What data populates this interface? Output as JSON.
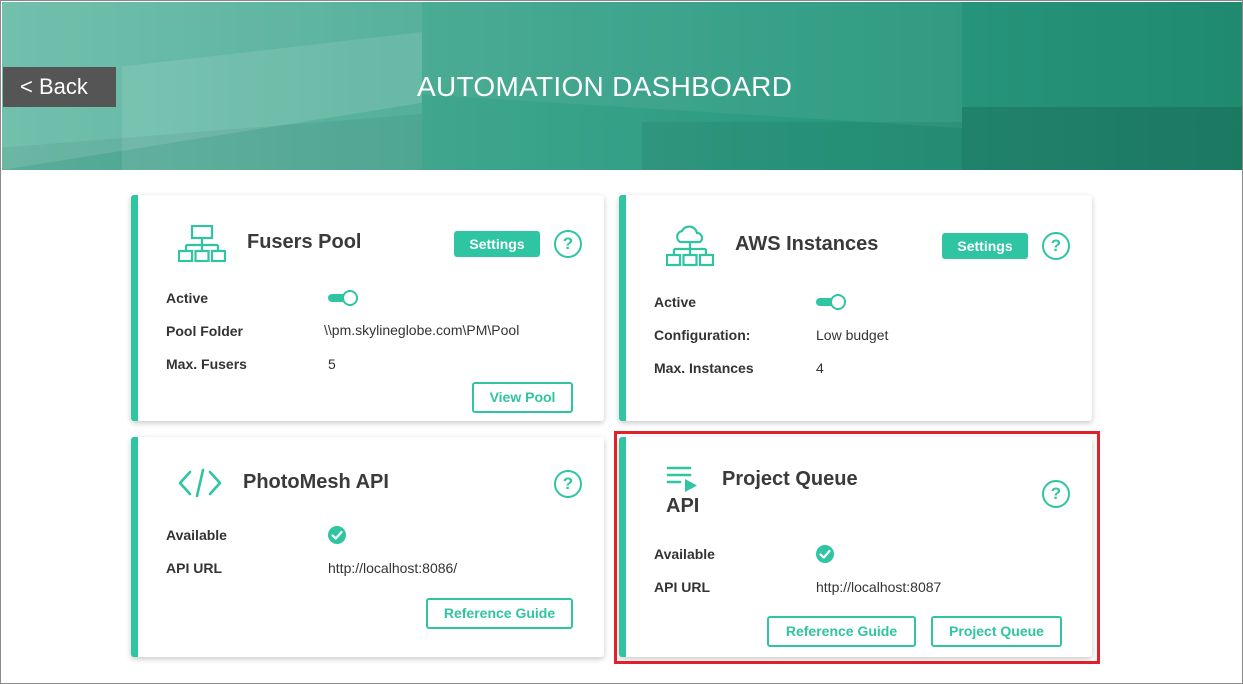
{
  "header": {
    "back_label": "< Back",
    "title": "AUTOMATION DASHBOARD"
  },
  "colors": {
    "accent": "#2fc4a2",
    "back_button_bg": "#555555",
    "highlight_border": "#e0202a"
  },
  "cards": {
    "fusers_pool": {
      "title": "Fusers Pool",
      "icon": "network-hierarchy-icon",
      "settings_label": "Settings",
      "help_label": "?",
      "rows": [
        {
          "label": "Active",
          "value": ""
        },
        {
          "label": "Pool Folder",
          "value": "\\\\pm.skylineglobe.com\\PM\\Pool"
        },
        {
          "label": "Max. Fusers",
          "value": "5"
        }
      ],
      "active": true,
      "button_label": "View Pool"
    },
    "aws_instances": {
      "title": "AWS Instances",
      "icon": "cloud-network-icon",
      "settings_label": "Settings",
      "help_label": "?",
      "rows": [
        {
          "label": "Active",
          "value": ""
        },
        {
          "label": "Configuration:",
          "value": "Low budget"
        },
        {
          "label": "Max. Instances",
          "value": "4"
        }
      ],
      "active": true
    },
    "photomesh_api": {
      "title": "PhotoMesh API",
      "icon": "code-brackets-icon",
      "help_label": "?",
      "rows": [
        {
          "label": "Available",
          "value": ""
        },
        {
          "label": "API URL",
          "value": "http://localhost:8086/"
        }
      ],
      "available": true,
      "button_label": "Reference Guide"
    },
    "project_queue": {
      "title": "Project Queue",
      "icon": "queue-list-icon",
      "icon_caption": "API",
      "help_label": "?",
      "rows": [
        {
          "label": "Available",
          "value": ""
        },
        {
          "label": "API URL",
          "value": "http://localhost:8087"
        }
      ],
      "available": true,
      "buttons": [
        "Reference Guide",
        "Project Queue"
      ]
    }
  }
}
